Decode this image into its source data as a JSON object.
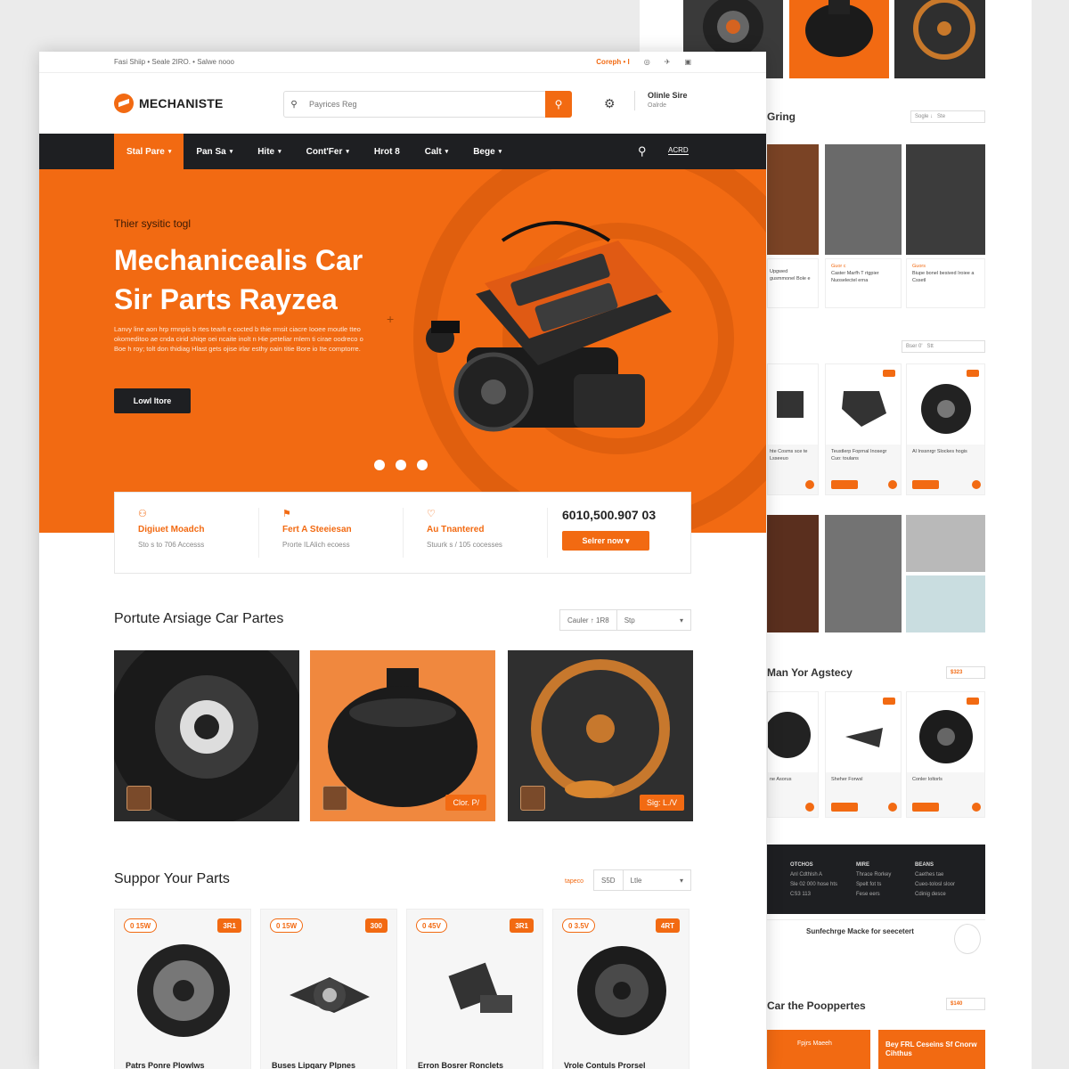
{
  "brand": {
    "name": "MECHANISTE",
    "accent": "#f26a12",
    "dark": "#1e1f22"
  },
  "topbar": {
    "left": "Fasi Shiip • Seale 2IRO. • Salwe nooo",
    "right_link": "Coreph • I",
    "icons": [
      "instagram-icon",
      "twitter-icon",
      "facebook-icon"
    ]
  },
  "header": {
    "search_placeholder": "Payrices Reg",
    "online_title": "Olinle Sire",
    "online_sub": "Oalrde"
  },
  "nav": {
    "items": [
      {
        "label": "Stal Pare",
        "active": true
      },
      {
        "label": "Pan Sa",
        "active": false
      },
      {
        "label": "Hite",
        "active": false
      },
      {
        "label": "Cont'Fer",
        "active": false
      },
      {
        "label": "Hrot 8",
        "active": false
      },
      {
        "label": "Calt",
        "active": false
      },
      {
        "label": "Bege",
        "active": false
      }
    ],
    "cart_label": "ACRD"
  },
  "hero": {
    "kicker": "Thier sysitic togl",
    "title_line1": "Mechanicealis Car",
    "title_line2": "Sir Parts Rayzea",
    "paragraph": "Lanvy line aon hrp rmnpis b rtes tearlt e cocted b thie rmsit ciacre Iooee moutle tteo okomeditoo ae cnda cirid shiqe oei ncaite inolt n Hie peteliar mlem ti cirae oodreco o Boe h roy; tolt don thidiag Hlast gets ojise irlar esthy oain titie Bore io Ite comptorre.",
    "cta_label": "Lowl Itore",
    "slides": 3,
    "active_slide": 1
  },
  "features": [
    {
      "icon": "user-icon",
      "title": "Digiuet Moadch",
      "sub": "Sto s to 706 Accesss"
    },
    {
      "icon": "bookmark-icon",
      "title": "Fert A Steeiesan",
      "sub": "Prorte ILAlich ecoess"
    },
    {
      "icon": "heart-icon",
      "title": "Au Tnantered",
      "sub": "Stuurk s / 105 cocesses"
    }
  ],
  "stat": {
    "value": "6010,500.907 03",
    "button": "Selrer now"
  },
  "section1": {
    "title": "Portute Arsiage Car Partes",
    "sort_a": "Cauler ↑ 1R8",
    "sort_b": "Stp"
  },
  "tiles": [
    {
      "label": "",
      "kind": "hub"
    },
    {
      "label": "Clor. P/",
      "kind": "pulley"
    },
    {
      "label": "Sig: L./V",
      "kind": "rim"
    }
  ],
  "section2": {
    "title": "Suppor Your Parts",
    "sort_pre": "tapeco",
    "sort_a": "S5D",
    "sort_b": "Ltle"
  },
  "products": [
    {
      "tag": "0 15W",
      "badge": "3R1",
      "name": "Patrs Ponre Plowlws",
      "kind": "wheel"
    },
    {
      "tag": "0 15W",
      "badge": "300",
      "name": "Buses Lipqary Plpnes",
      "kind": "gear"
    },
    {
      "tag": "0 45V",
      "badge": "3R1",
      "name": "Erron Bosrer Ronclets",
      "kind": "bracket"
    },
    {
      "tag": "0 3.5V",
      "badge": "4RT",
      "name": "Vrole Contuls Prorsel",
      "kind": "rim"
    }
  ],
  "back": {
    "title_a": "Gring",
    "title_b": "Man Yor Agstecy",
    "title_c": "Car the Pooppertes",
    "price_a": "$323",
    "price_b": "$140",
    "sort_a": "Sogle ↓",
    "sort_b": "Ste",
    "sort_c": "Bser 0'",
    "sort_d": "Stt",
    "row1_captions": [
      {
        "top": "Upgwed",
        "body": "gusmmonel Bole e"
      },
      {
        "top": "Guor c",
        "body": "Caster Marfh T rtgpier Nuoselectel erna"
      },
      {
        "top": "Guors",
        "body": "Biupe bonel besived Iroiee a Cssetl"
      }
    ],
    "row2_captions": [
      {
        "body": "hte Cosms sce te Lsseeuo"
      },
      {
        "body": "Teustlerp Foprnal Inosegr Cuo: toulans"
      },
      {
        "body": "Al Inssnrgr Slockes hogis"
      }
    ],
    "row3_captions": [
      {
        "body": "ne Asorus"
      },
      {
        "body": "Sheher Forwsl"
      },
      {
        "body": "Conler Ioltorls"
      }
    ],
    "footer_cols": [
      {
        "head": "OTCHOS",
        "lines": [
          "Anl Cdthlsh A",
          "Sle 02 000 hose hts",
          "CS3 113"
        ]
      },
      {
        "head": "MIRE",
        "lines": [
          "Thrace Rorkey",
          "Spelt fot ts",
          "Fese eers"
        ]
      },
      {
        "head": "BEANS",
        "lines": [
          "Caethes tae",
          "Cueo-tolosl sloor",
          "Cdinig desce"
        ]
      }
    ],
    "newsletter": "Sunfechrge Macke for seecetert",
    "promo_a": "Fpjrs Maeeh",
    "promo_b": "Bey FRL Ceseins Sf Cnorw Cihthus"
  }
}
